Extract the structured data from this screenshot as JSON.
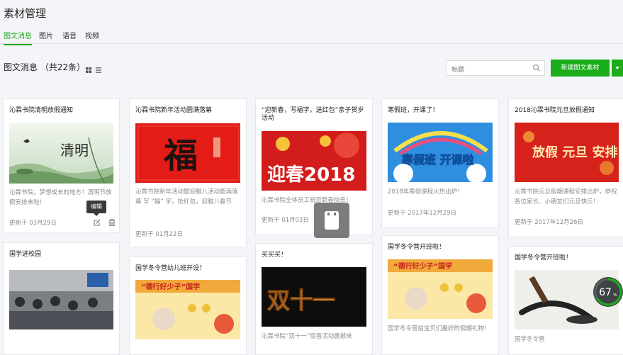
{
  "page": {
    "title": "素材管理"
  },
  "tabs": [
    {
      "label": "图文消息",
      "active": true
    },
    {
      "label": "图片",
      "active": false
    },
    {
      "label": "语音",
      "active": false
    },
    {
      "label": "视频",
      "active": false
    }
  ],
  "list": {
    "title": "图文消息 （共22条）"
  },
  "search": {
    "placeholder": "标题"
  },
  "new_button": {
    "label": "新建图文素材"
  },
  "tooltip": {
    "text": "编辑"
  },
  "cards": [
    {
      "title": "沁霖书院清明放假通知",
      "thumb_text": "清明",
      "desc": "沁霖书院，梦想成长的地方！清明节放假安排来啦！",
      "date": "更新于 03月29日"
    },
    {
      "title": "沁霖书院新年活动圆满落幕",
      "thumb_text": "福",
      "desc": "沁霖书院新年活动暨迎腊八活动圆满落幕 写 “福” 字，抢红包，迎腊八春节",
      "date": "更新于 01月22日"
    },
    {
      "title": "“迎新春，写福字，送红包”亲子贺岁活动",
      "thumb_text": "迎春2018",
      "desc": "沁霖书院全体员工祝您新春快乐！",
      "date": "更新于 01月03日"
    },
    {
      "title": "寒假班，开课了！",
      "thumb_text": "寒假班 开课啦",
      "desc": "2018年寒假课程火热出炉！",
      "date": "更新于 2017年12月29日"
    },
    {
      "title": "2018沁霖书院元旦放假通知",
      "thumb_text": "放假 元旦 安排",
      "desc": "沁霖书院元旦假期课程安排出炉，恭祝各位家长、小朋友们元旦快乐！",
      "date": "更新于 2017年12月26日"
    },
    {
      "title": "国学进校园",
      "desc": "",
      "date": ""
    },
    {
      "title": "国学冬令营幼儿班开设！",
      "thumb_text": "“德行好少子”国学",
      "desc": "",
      "date": ""
    },
    {
      "title": "买买买！",
      "thumb_text": "双十一",
      "desc": "沁霖书院“双十一”惊喜活动震撼来",
      "date": ""
    },
    {
      "title": "国学冬令营开班啦！",
      "thumb_text": "“德行好少子”国学",
      "desc": "国学冬令营给宝贝们最好的假期礼物！",
      "date": ""
    },
    {
      "title": "国学冬令营开班啦！",
      "desc": "国学冬令营",
      "date": ""
    }
  ],
  "progress": {
    "percent": "67",
    "unit": "%"
  },
  "colors": {
    "accent": "#1aad19"
  }
}
